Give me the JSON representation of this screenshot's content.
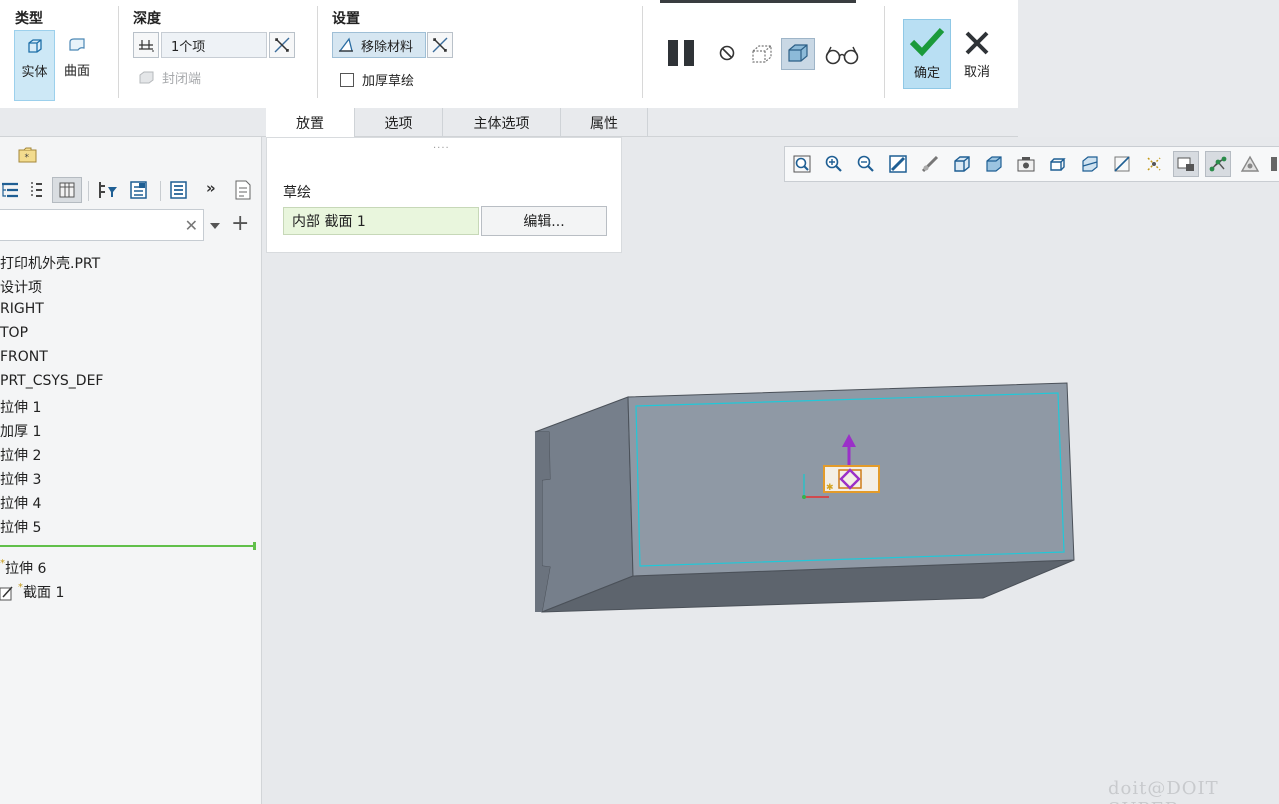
{
  "ribbon": {
    "type_group": {
      "title": "类型",
      "solid_label": "实体",
      "surface_label": "曲面"
    },
    "depth_group": {
      "title": "深度",
      "value": "1个项",
      "capped_ends_label": "封闭端"
    },
    "settings_group": {
      "title": "设置",
      "remove_material_label": "移除材料",
      "thicken_sketch_label": "加厚草绘"
    },
    "control": {
      "ok_label": "确定",
      "cancel_label": "取消"
    }
  },
  "tabs": [
    "放置",
    "选项",
    "主体选项",
    "属性"
  ],
  "placement_panel": {
    "heading": "草绘",
    "section_value": "内部 截面 1",
    "edit_button": "编辑..."
  },
  "model_tree": {
    "items": [
      "打印机外壳.PRT",
      "设计项",
      "RIGHT",
      "TOP",
      "FRONT",
      "PRT_CSYS_DEF",
      "拉伸 1",
      "加厚 1",
      "拉伸 2",
      "拉伸 3",
      "拉伸 4",
      "拉伸 5"
    ],
    "inserted_feature": "拉伸 6",
    "inserted_section": "截面 1"
  },
  "watermark": "doit@DOIT SUPER",
  "colors": {
    "model_top_face": "#8f99a5",
    "model_side_face": "#767f8b",
    "model_front_face": "#5d646d",
    "sketch_edge": "#21c8d8",
    "accent_selected": "#cde8f6",
    "insert_line": "#61c04a"
  },
  "icons": {
    "pause": "pause-icon",
    "stop": "stop-icon",
    "ok": "checkmark-icon",
    "cancel": "x-icon"
  }
}
